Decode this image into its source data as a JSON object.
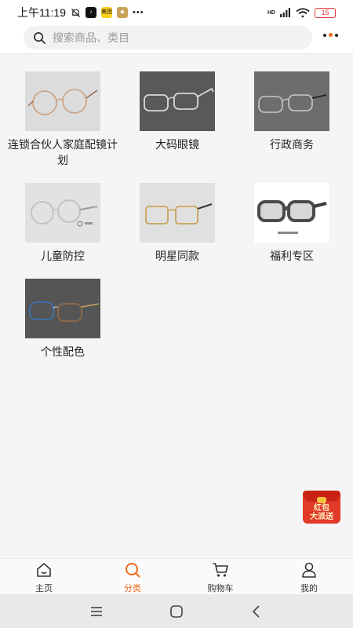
{
  "status_bar": {
    "time": "上午11:19",
    "app_chip_1": "美团",
    "app_chip_2": "抖音",
    "more": "•••",
    "network": "HD",
    "battery": "15"
  },
  "search": {
    "placeholder": "搜索商品、类目"
  },
  "categories": [
    {
      "label": "连锁合伙人家庭配镜计划",
      "icon": "round-gold-glasses"
    },
    {
      "label": "大码眼镜",
      "icon": "silver-rimless-glasses"
    },
    {
      "label": "行政商务",
      "icon": "business-titanium-glasses"
    },
    {
      "label": "儿童防控",
      "icon": "kids-glasses"
    },
    {
      "label": "明星同款",
      "icon": "gold-square-glasses"
    },
    {
      "label": "福利专区",
      "icon": "sports-glasses"
    },
    {
      "label": "个性配色",
      "icon": "colorful-glasses"
    }
  ],
  "float_badge": {
    "line1": "红包",
    "line2": "大派送"
  },
  "tabbar": {
    "items": [
      {
        "label": "主页",
        "icon": "home-icon"
      },
      {
        "label": "分类",
        "icon": "search-icon"
      },
      {
        "label": "购物车",
        "icon": "cart-icon"
      },
      {
        "label": "我的",
        "icon": "user-icon"
      }
    ],
    "active_color": "#f06a1a"
  },
  "colors": {
    "accent": "#f06a1a",
    "background": "#f5f5f5"
  }
}
